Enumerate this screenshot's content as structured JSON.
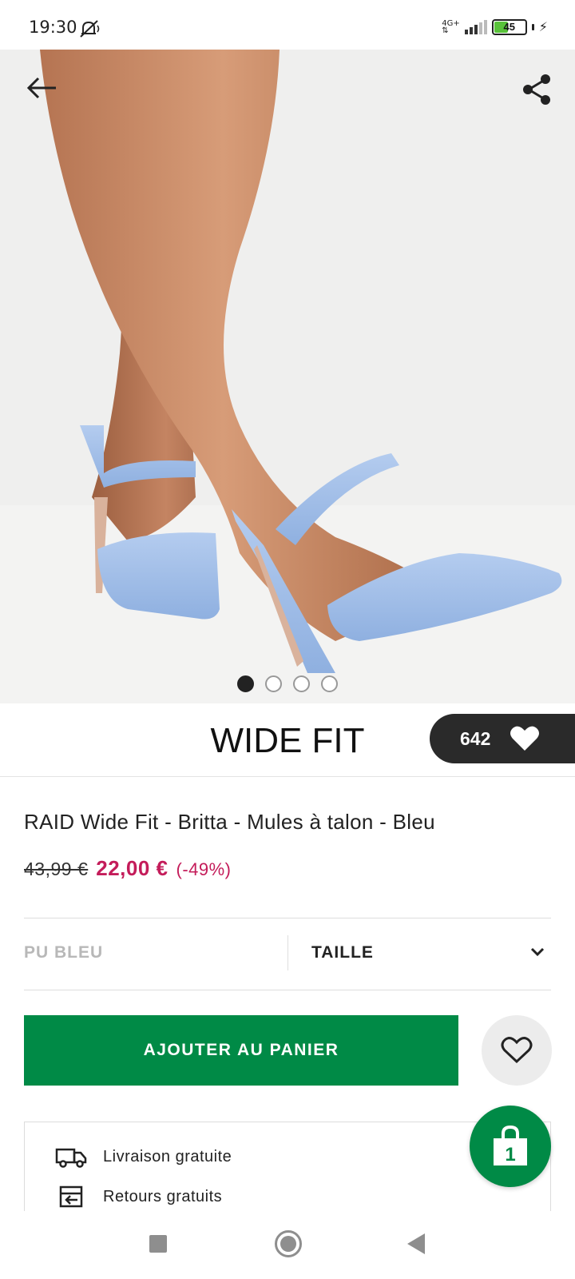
{
  "status_bar": {
    "time": "19:30",
    "network": "4G+",
    "battery": "45"
  },
  "hero": {
    "image_count": 4,
    "active_index": 0,
    "icons": [
      "back-arrow-icon",
      "share-icon"
    ]
  },
  "brand": {
    "logo_text": "WIDE FIT"
  },
  "likes": {
    "count": "642"
  },
  "product": {
    "title": "RAID Wide Fit - Britta - Mules à talon - Bleu",
    "price_old": "43,99 €",
    "price_new": "22,00 €",
    "discount": "(-49%)"
  },
  "selectors": {
    "color": "PU BLEU",
    "size_label": "TAILLE"
  },
  "actions": {
    "add_to_cart": "AJOUTER AU PANIER",
    "cart_count": "1"
  },
  "perks": [
    {
      "icon": "truck-icon",
      "text": "Livraison gratuite"
    },
    {
      "icon": "return-box-icon",
      "text": "Retours gratuits"
    }
  ],
  "colors": {
    "accent_green": "#008a46",
    "sale_pink": "#c41c5a",
    "dark_pill": "#2a2a2a"
  }
}
